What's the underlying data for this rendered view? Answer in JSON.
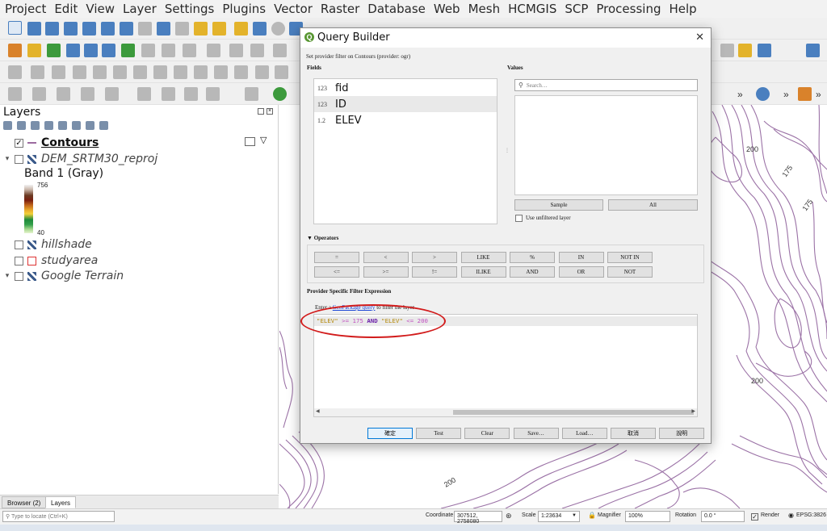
{
  "menu": [
    "Project",
    "Edit",
    "View",
    "Layer",
    "Settings",
    "Plugins",
    "Vector",
    "Raster",
    "Database",
    "Web",
    "Mesh",
    "HCMGIS",
    "SCP",
    "Processing",
    "Help"
  ],
  "layers_panel": {
    "title": "Layers",
    "layers": [
      {
        "name": "Contours",
        "checked": true
      },
      {
        "name": "DEM_SRTM30_reproj"
      },
      {
        "name": "hillshade"
      },
      {
        "name": "studyarea"
      },
      {
        "name": "Google Terrain"
      }
    ],
    "legend": {
      "band": "Band 1 (Gray)",
      "max": "756",
      "min": "40"
    }
  },
  "bottom_tabs": [
    "Browser (2)",
    "Layers"
  ],
  "dialog": {
    "title": "Query Builder",
    "subtitle": "Set provider filter on Contours (provider: ogr)",
    "fields_label": "Fields",
    "fields": [
      {
        "type": "123",
        "name": "fid"
      },
      {
        "type": "123",
        "name": "ID",
        "selected": true
      },
      {
        "type": "1.2",
        "name": "ELEV"
      }
    ],
    "values_label": "Values",
    "search_placeholder": "Search…",
    "sample_label": "Sample",
    "all_label": "All",
    "unfiltered_label": "Use unfiltered layer",
    "operators_label": "Operators",
    "operators_row1": [
      "=",
      "<",
      ">",
      "LIKE",
      "%",
      "IN",
      "NOT IN"
    ],
    "operators_row2": [
      "<=",
      ">=",
      "!=",
      "ILIKE",
      "AND",
      "OR",
      "NOT"
    ],
    "expr_label": "Provider Specific Filter Expression",
    "hint_before": "Enter a ",
    "hint_link": "GeoPackage query",
    "hint_after": " to filter the layer",
    "expression": {
      "f1": "\"ELEV\"",
      "op1": ">=",
      "v1": "175",
      "kw": "AND",
      "f2": "\"ELEV\"",
      "op2": "<=",
      "v2": "200"
    },
    "buttons": [
      "確定",
      "Test",
      "Clear",
      "Save…",
      "Load…",
      "取消",
      "說明"
    ]
  },
  "map": {
    "contour_labels": [
      "200",
      "175",
      "175",
      "200",
      "200"
    ],
    "contour_color": "#9b72a6"
  },
  "toolbar": {
    "zoom_text": "»"
  },
  "status": {
    "locate_placeholder": "Type to locate (Ctrl+K)",
    "coordinate_label": "Coordinate",
    "coordinate_value": "307512, 2758080",
    "scale_label": "Scale",
    "scale_value": "1:23634",
    "magnifier_label": "Magnifier",
    "magnifier_value": "100%",
    "rotation_label": "Rotation",
    "rotation_value": "0.0 °",
    "render_label": "Render",
    "crs_label": "EPSG:3826"
  },
  "colors": {
    "accent": "#589632",
    "highlight": "#d21b1b",
    "link": "#1a45d6"
  }
}
